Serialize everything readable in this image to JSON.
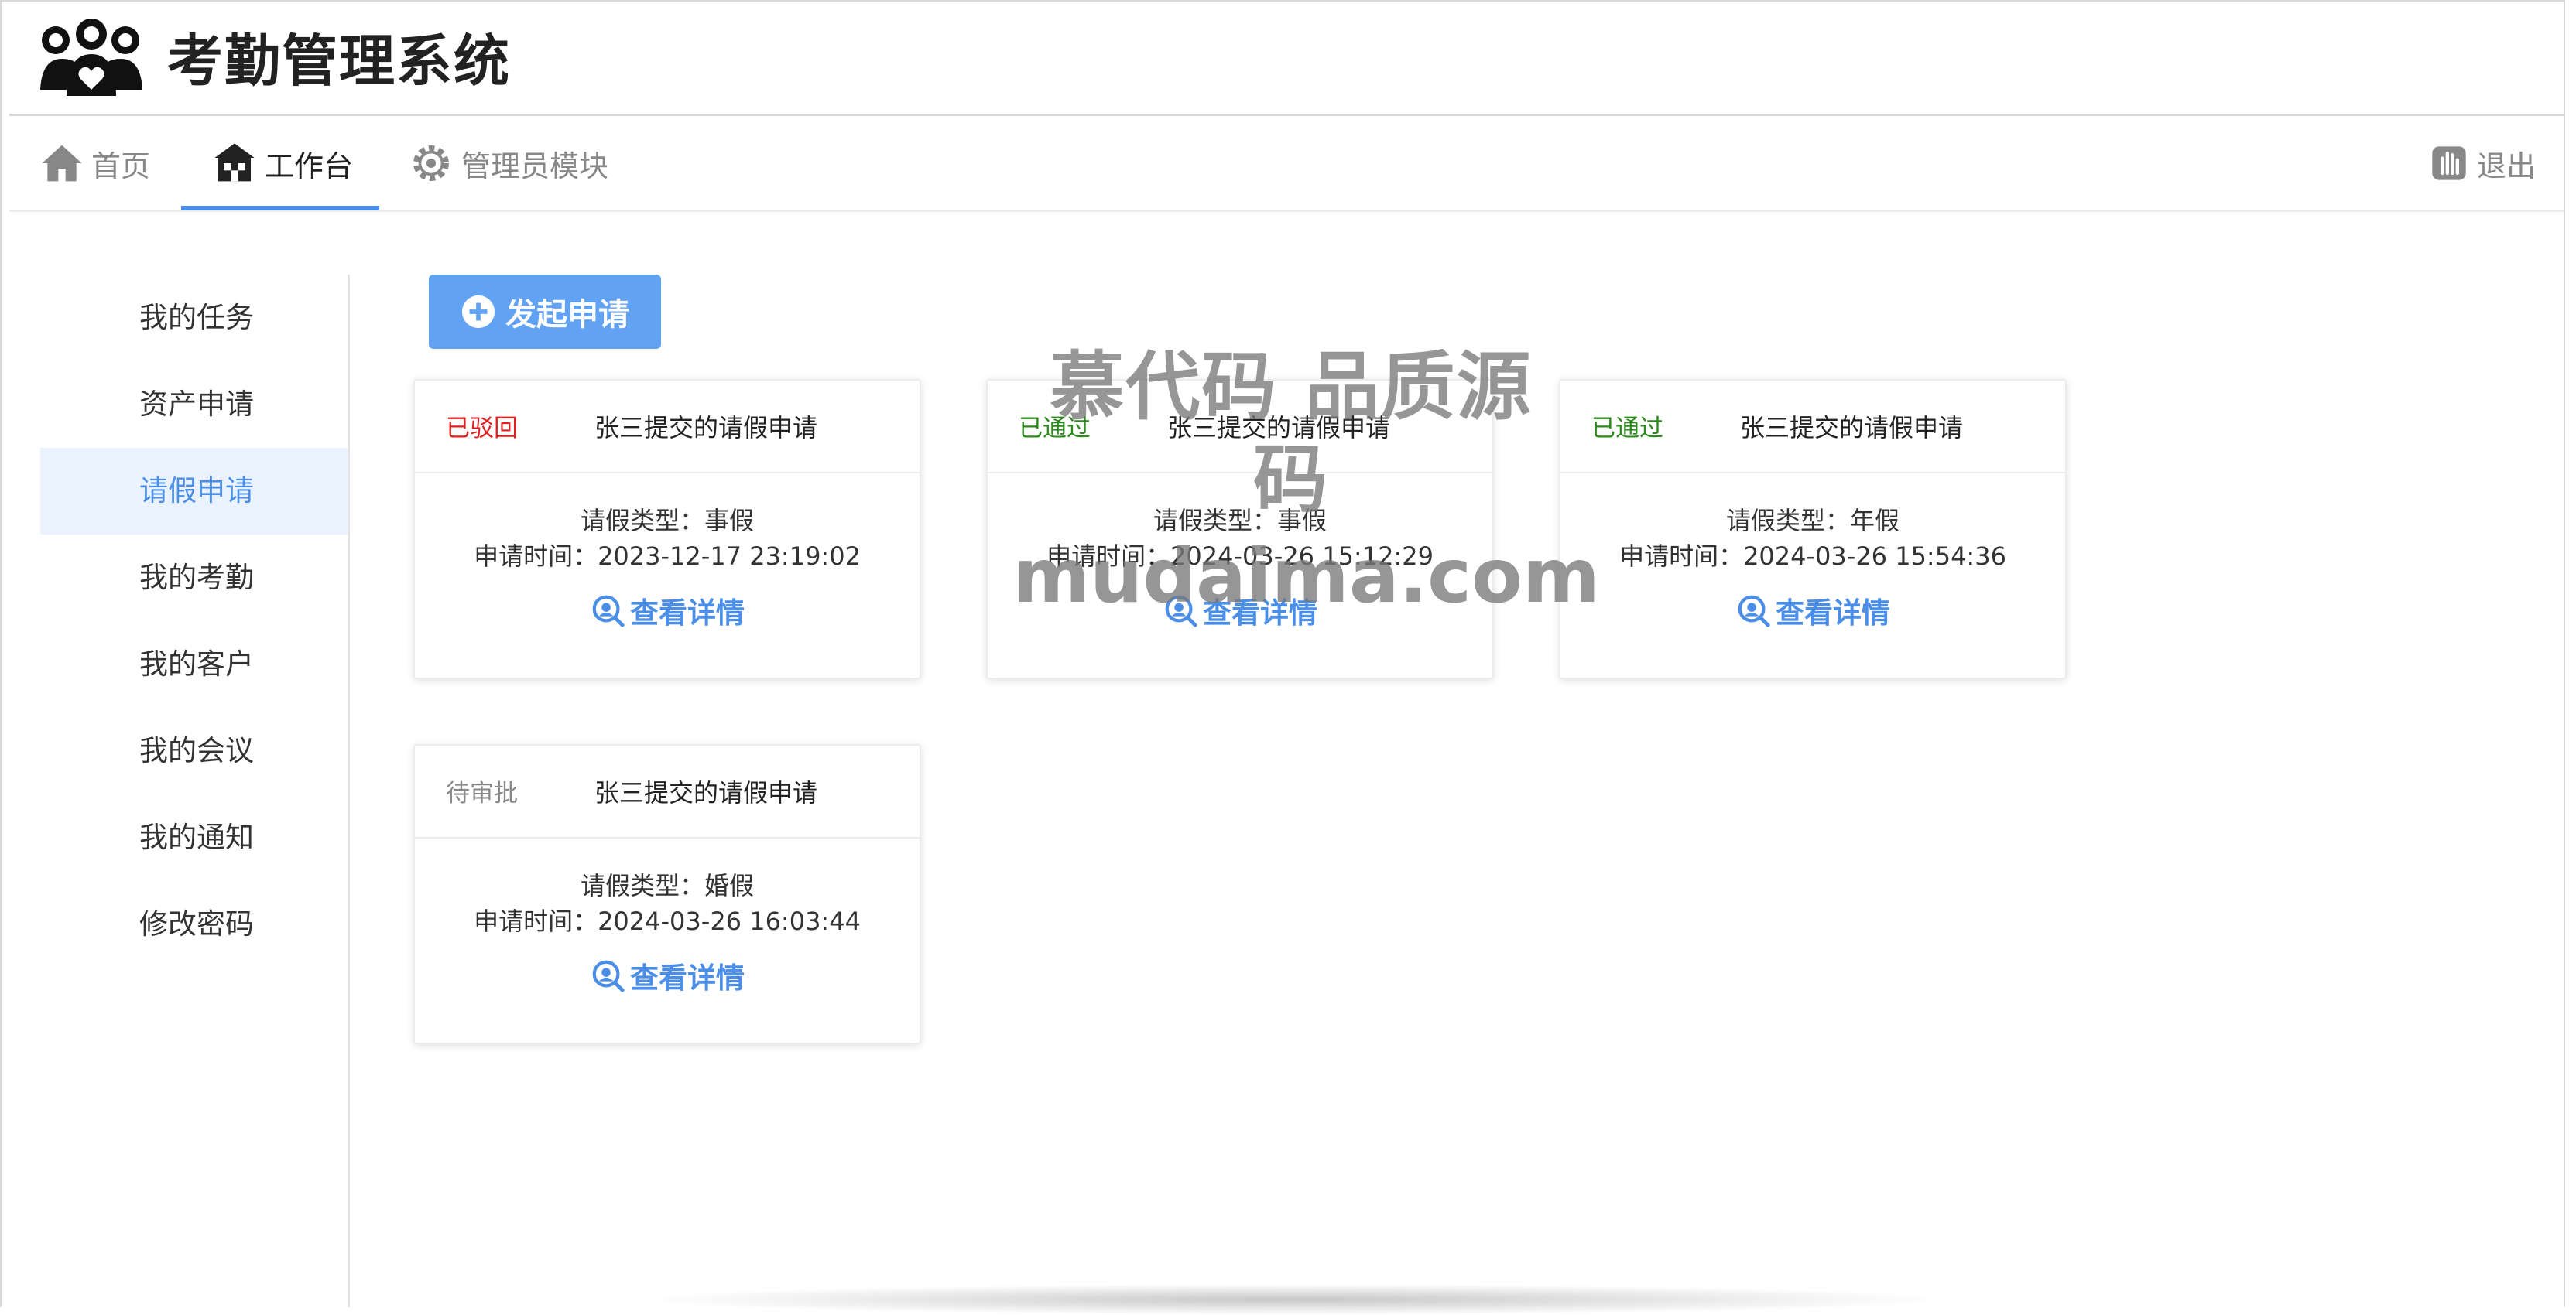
{
  "header": {
    "app_title": "考勤管理系统"
  },
  "nav": {
    "items": [
      {
        "label": "首页",
        "icon": "home-icon"
      },
      {
        "label": "工作台",
        "icon": "workbench-icon"
      },
      {
        "label": "管理员模块",
        "icon": "gear-icon"
      }
    ],
    "active": "工作台",
    "logout_label": "退出",
    "accent_color": "#4a8ee8"
  },
  "sidebar": {
    "items": [
      {
        "label": "我的任务"
      },
      {
        "label": "资产申请"
      },
      {
        "label": "请假申请"
      },
      {
        "label": "我的考勤"
      },
      {
        "label": "我的客户"
      },
      {
        "label": "我的会议"
      },
      {
        "label": "我的通知"
      },
      {
        "label": "修改密码"
      }
    ],
    "active": "请假申请"
  },
  "main": {
    "apply_button_label": "发起申请",
    "cards": [
      {
        "status": "已驳回",
        "status_color": "#e02020",
        "title": "张三提交的请假申请",
        "type_line": "请假类型：事假",
        "time_line": "申请时间：2023-12-17 23:19:02",
        "link_label": "查看详情"
      },
      {
        "status": "已通过",
        "status_color": "#2a8a1a",
        "title": "张三提交的请假申请",
        "type_line": "请假类型：事假",
        "time_line": "申请时间：2024-03-26 15:12:29",
        "link_label": "查看详情"
      },
      {
        "status": "已通过",
        "status_color": "#2a8a1a",
        "title": "张三提交的请假申请",
        "type_line": "请假类型：年假",
        "time_line": "申请时间：2024-03-26 15:54:36",
        "link_label": "查看详情"
      },
      {
        "status": "待审批",
        "status_color": "#888888",
        "title": "张三提交的请假申请",
        "type_line": "请假类型：婚假",
        "time_line": "申请时间：2024-03-26 16:03:44",
        "link_label": "查看详情"
      }
    ]
  },
  "watermark": {
    "line1": "慕代码 品质源码",
    "line2": "mudaima.com"
  }
}
